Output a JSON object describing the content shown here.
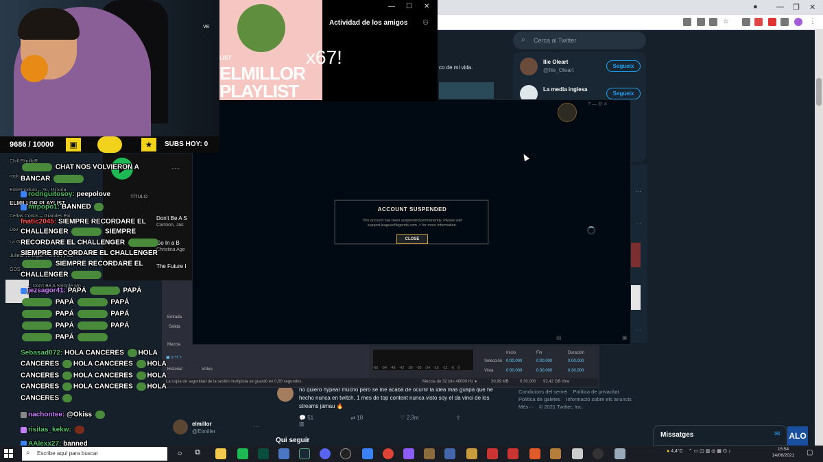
{
  "twitter": {
    "search_placeholder": "Cerca al Twitter",
    "follow": [
      {
        "name": "Ilie Oleart",
        "handle": "@Ilie_Oleart",
        "button": "Segueix"
      },
      {
        "name": "La media inglesa",
        "handle": "",
        "button": "Segueix"
      }
    ],
    "partial_text": "co de mi vida.",
    "tweet": {
      "text": "no quiero hypear mucho pero se me acaba de ocurrir la idea más guapa que he hecho nunca en twitch, 1 mes de top content nunca visto soy el da vinci de los streams jamau 🔥",
      "replies": "51",
      "retweets": "18",
      "likes": "2,3m"
    },
    "account": {
      "name": "elmillor",
      "handle": "@Elmiller"
    },
    "who_to_follow": "Qui seguir",
    "footer": [
      "Condicions del servei",
      "Política de privacitat",
      "Política de galetes",
      "Informació sobre els anuncis",
      "Més···",
      "© 2021 Twitter, Inc."
    ],
    "messages": "Missatges"
  },
  "lol": {
    "dialog_title": "ACCOUNT SUSPENDED",
    "dialog_message": "This account has been suspended permanently. Please visit support.leagueoflegends.com ↗ for more information.",
    "close_label": "CLOSE"
  },
  "spotify": {
    "friends_title": "Actividad de los amigos",
    "cover_title": "ELMILLOR PLAYLIST",
    "cover_tag": "LIST",
    "multiplier": "x67!"
  },
  "stream": {
    "sub_count": "9686 / 10000",
    "subs_today": "SUBS HOY: 0",
    "cam_label": "VE"
  },
  "behind_list": {
    "col_title": "TÍTULO",
    "rows": [
      "Don't Be A S",
      "Cartoon, Jas",
      "Go In a B",
      "Christina Age",
      "The Future I"
    ]
  },
  "chat": {
    "lines": [
      {
        "user": "",
        "text": "CHAT NOS VOLVIERON A",
        "cls": ""
      },
      {
        "user": "",
        "text": "BANCAR",
        "cls": ""
      },
      {
        "user": "rodriguitosoy:",
        "text": "peepolove",
        "cls": "user"
      },
      {
        "user": "mrpopo1:",
        "text": "BANNED",
        "cls": "user"
      },
      {
        "user": "fnatic2045:",
        "text": "SIEMPRE RECORDARE EL",
        "cls": "user-r"
      },
      {
        "user": "",
        "text": "CHALLENGER",
        "cls": ""
      },
      {
        "user": "",
        "text": "SIEMPRE",
        "cls": ""
      },
      {
        "user": "",
        "text": "RECORDARE EL CHALLENGER",
        "cls": ""
      },
      {
        "user": "",
        "text": "SIEMPRE RECORDARE EL CHALLENGER",
        "cls": ""
      },
      {
        "user": "",
        "text": "SIEMPRE RECORDARE EL",
        "cls": ""
      },
      {
        "user": "",
        "text": "CHALLENGER",
        "cls": ""
      },
      {
        "user": "jezsagor41:",
        "text": "PAPÁ",
        "cls": "user-p"
      },
      {
        "user": "",
        "text": "PAPÁ",
        "cls": ""
      },
      {
        "user": "Sebasad072:",
        "text": "HOLA CANCERES",
        "cls": "user"
      },
      {
        "user": "",
        "text": "CANCERES",
        "cls": ""
      },
      {
        "user": "nachontee:",
        "text": "@Okiss",
        "cls": "user-p"
      },
      {
        "user": "risitas_kekw:",
        "text": "",
        "cls": "user"
      },
      {
        "user": "AAlexx27:",
        "text": "banned",
        "cls": "user"
      }
    ],
    "faint": [
      "Chill ElmilloR",
      "rock",
      "Extremoduro – Yo, Minoria",
      "ELMILLOR PLAYLIST",
      "Celtas Cortos – Grandes Éxi",
      "Dov",
      "La G",
      "Julieta Venegas – Limón y sal",
      "GOS",
      "Don't Be A Sample Mo"
    ],
    "papa": "PAPÁ",
    "hola": "HOLA CANCERES",
    "hola_short": "HOLA"
  },
  "obs": {
    "tabs": [
      "Historial",
      "Vídeo"
    ],
    "labels": [
      "Entrada",
      "Salida",
      "Mezcla"
    ],
    "table_headers": [
      "Inicio",
      "Fin",
      "Duración"
    ],
    "rows": [
      {
        "label": "Selección",
        "inicio": "0:00.000",
        "fin": "0:00.000",
        "dur": "0:00.000"
      },
      {
        "label": "Vista",
        "inicio": "0:00.000",
        "fin": "0:30.000",
        "dur": "0:30.000"
      }
    ],
    "status": "La copia de seguridad de la sesión multipista se guardó en 0,00 segundos",
    "status_right": [
      "Mezcla de 32 bits 48000 Hz ●",
      "30,99 MB",
      "0:30.000",
      "92,42 GB libre"
    ],
    "meter_ticks": [
      "-66",
      "-54",
      "-48",
      "-42",
      "-36",
      "-30",
      "-24",
      "-18",
      "-12",
      "-6",
      "0"
    ]
  },
  "taskbar": {
    "search_placeholder": "Escribe aquí para buscar",
    "weather": "4,4°C",
    "time": "15:54",
    "date": "14/06/2021"
  },
  "watermark": "ALO"
}
